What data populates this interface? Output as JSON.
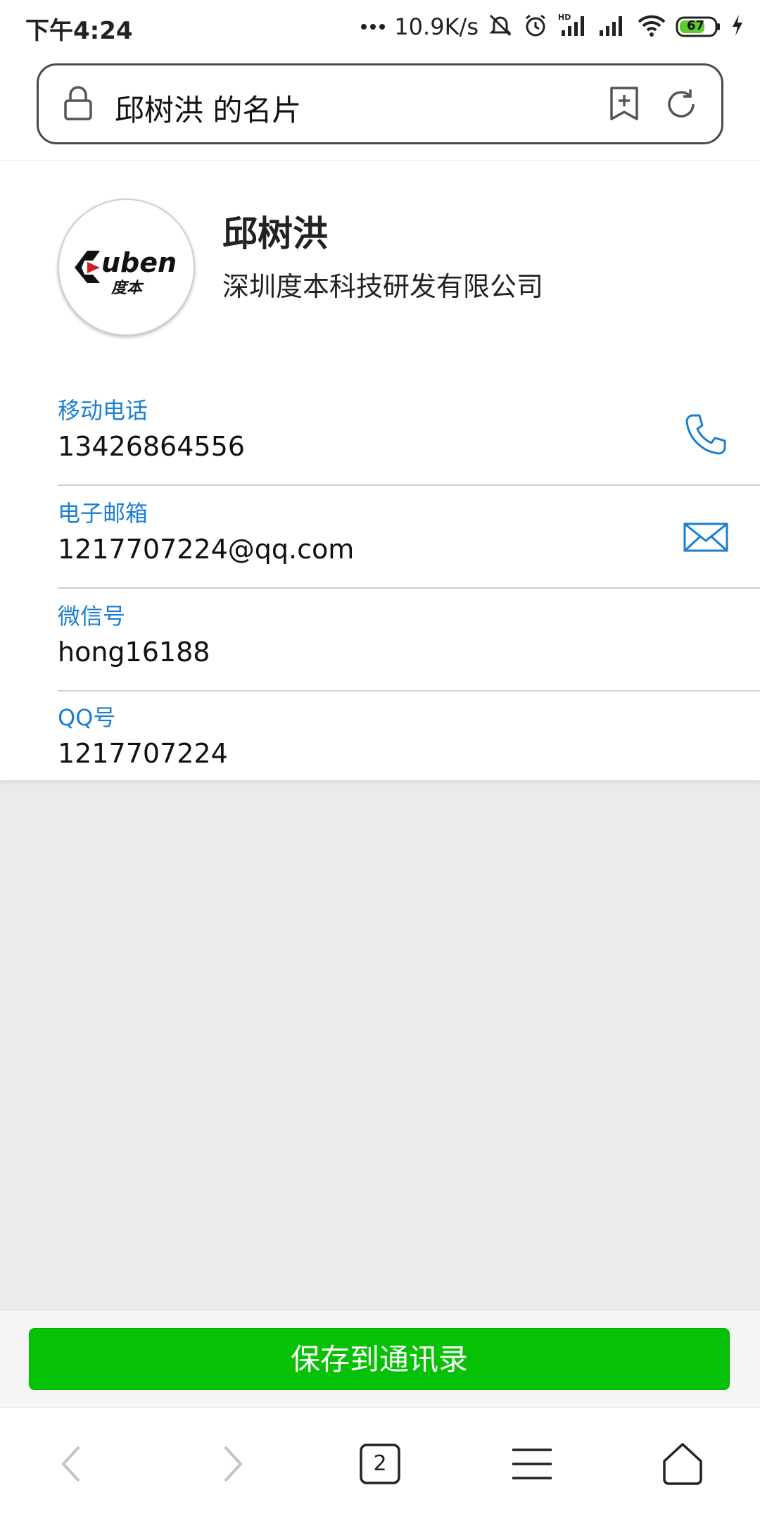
{
  "status_bar": {
    "time": "下午4:24",
    "net_speed": "10.9K/s",
    "battery": "67",
    "signal_badge": "HD"
  },
  "address_bar": {
    "title": "邱树洪 的名片"
  },
  "card": {
    "logo_text": "uben",
    "logo_subtext": "度本",
    "name": "邱树洪",
    "company": "深圳度本科技研发有限公司",
    "fields": [
      {
        "label": "移动电话",
        "value": "13426864556"
      },
      {
        "label": "电子邮箱",
        "value": "1217707224@qq.com"
      },
      {
        "label": "微信号",
        "value": "hong16188"
      },
      {
        "label": "QQ号",
        "value": "1217707224"
      }
    ]
  },
  "actions": {
    "save_label": "保存到通讯录"
  },
  "browser_nav": {
    "tab_count": "2"
  },
  "colors": {
    "accent_blue": "#1a7fd0",
    "save_green": "#07c107"
  }
}
